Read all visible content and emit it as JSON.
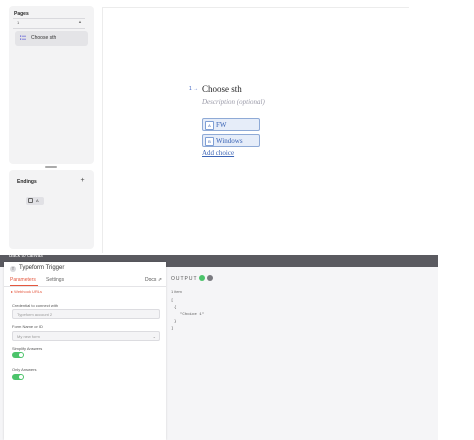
{
  "typeform": {
    "pages_panel": {
      "title": "Pages",
      "header_number": "1",
      "chevron_icon": "chevron-up-icon",
      "items": [
        {
          "icon": "list-choice-icon",
          "label": "Choose sth"
        }
      ]
    },
    "endings_panel": {
      "title": "Endings",
      "add_icon": "plus-icon",
      "ending_chip": {
        "icon": "ending-icon",
        "label": "A"
      }
    },
    "question": {
      "number": "1",
      "arrow": "→",
      "title": "Choose sth",
      "description_placeholder": "Description (optional)",
      "choices": [
        {
          "key": "A",
          "label": "FW"
        },
        {
          "key": "B",
          "label": "Windows"
        }
      ],
      "add_choice_label": "Add choice"
    },
    "colors": {
      "accent": "#3a63b5",
      "choice_bg": "#e6edf9",
      "choice_border": "#8faad6"
    }
  },
  "n8n": {
    "top_bar": {
      "back_label": "Back to canvas"
    },
    "node": {
      "icon": "typeform-icon",
      "title": "Typeform Trigger",
      "tabs": [
        {
          "label": "Parameters",
          "active": true
        },
        {
          "label": "Settings",
          "active": false
        }
      ],
      "docs_label": "Docs ⇗",
      "webhook_note": "▸ Webhook URLs",
      "fields": [
        {
          "label": "Credential to connect with",
          "value": "Typeform account 2"
        },
        {
          "label": "Form Name or ID",
          "value": "My new form",
          "caret": "⌄"
        }
      ],
      "toggles": [
        {
          "label": "Simplify Answers",
          "on": true
        },
        {
          "label": "Only Answers",
          "on": true
        }
      ]
    },
    "output": {
      "label": "OUTPUT",
      "status_icon": "check-circle-icon",
      "info_icon": "info-icon",
      "item_count": "1 item",
      "json_lines": [
        "[",
        "{",
        "\"Choice 1\"",
        "}",
        "]"
      ]
    },
    "colors": {
      "accent": "#e4573e",
      "success": "#4cc46b",
      "bar": "#5a5a60"
    }
  }
}
